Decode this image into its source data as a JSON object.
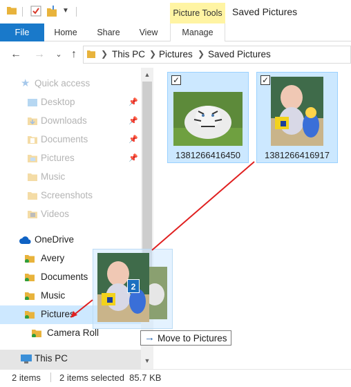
{
  "window": {
    "title": "Saved Pictures",
    "contextual_tab_group": "Picture Tools",
    "accent_color": "#1979ca",
    "selection_color": "#cce8ff"
  },
  "ribbon": {
    "tabs": [
      {
        "label": "File"
      },
      {
        "label": "Home"
      },
      {
        "label": "Share"
      },
      {
        "label": "View"
      },
      {
        "label": "Manage"
      }
    ]
  },
  "address_bar": {
    "breadcrumb": [
      "This PC",
      "Pictures",
      "Saved Pictures"
    ]
  },
  "nav_pane": {
    "quick_access": {
      "label": "Quick access",
      "items": [
        {
          "label": "Desktop",
          "pinned": true
        },
        {
          "label": "Downloads",
          "pinned": true
        },
        {
          "label": "Documents",
          "pinned": true
        },
        {
          "label": "Pictures",
          "pinned": true
        },
        {
          "label": "Music",
          "pinned": false
        },
        {
          "label": "Screenshots",
          "pinned": false
        },
        {
          "label": "Videos",
          "pinned": false
        }
      ]
    },
    "onedrive": {
      "label": "OneDrive",
      "items": [
        {
          "label": "Avery"
        },
        {
          "label": "Documents"
        },
        {
          "label": "Music"
        },
        {
          "label": "Pictures",
          "selected": true
        },
        {
          "label": "Camera Roll"
        }
      ]
    },
    "this_pc": {
      "label": "This PC"
    }
  },
  "files": [
    {
      "name": "1381266416450",
      "checked": true,
      "thumbnail": "white-tiger-photo"
    },
    {
      "name": "1381266416917",
      "checked": true,
      "thumbnail": "baby-with-toys-photo"
    }
  ],
  "drag": {
    "count_badge": "2",
    "tooltip_arrow": "→",
    "tooltip": "Move to Pictures"
  },
  "status_bar": {
    "item_count": "2 items",
    "selection": "2 items selected  85.7 KB"
  }
}
